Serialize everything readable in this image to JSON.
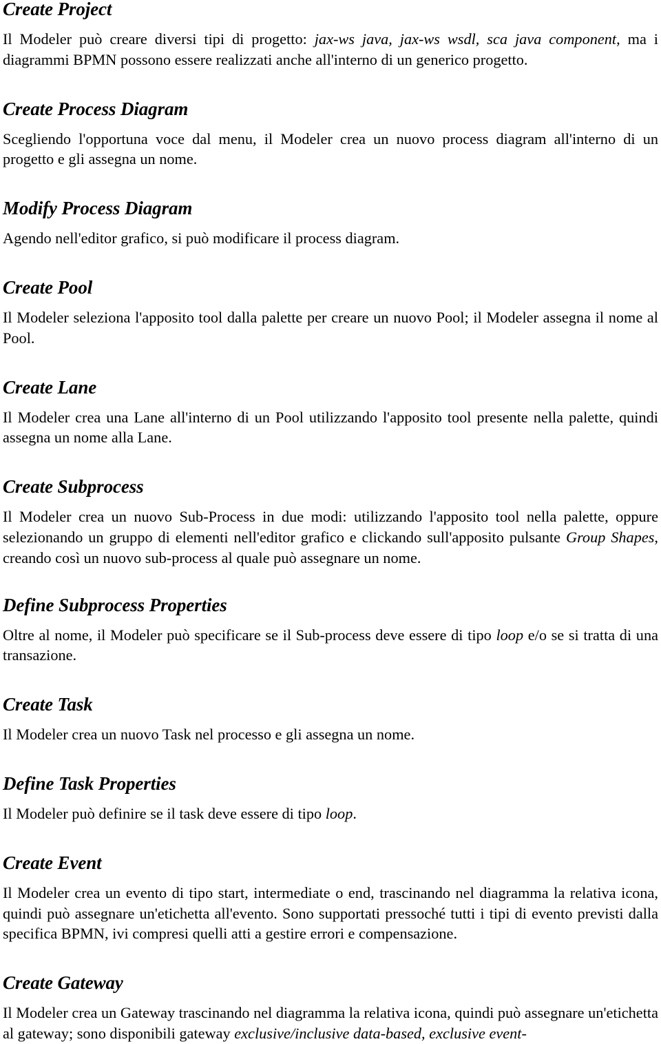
{
  "document": {
    "language": "it",
    "sections": [
      {
        "id": "create-project",
        "heading": "Create Project",
        "body_html": "Il Modeler può creare diversi tipi di progetto: <i>jax-ws java, jax-ws wsdl, sca java component</i>, ma i diagrammi BPMN possono essere realizzati anche all'interno di un generico progetto.",
        "body_text": "Il Modeler può creare diversi tipi di progetto: jax-ws java, jax-ws wsdl, sca java component, ma i diagrammi BPMN possono essere realizzati anche all'interno di un generico progetto.",
        "italic_runs": [
          "jax-ws java, jax-ws wsdl, sca java component"
        ],
        "lines": 2
      },
      {
        "id": "create-process-diagram",
        "heading": "Create Process Diagram",
        "body_html": "Scegliendo l'opportuna voce dal menu, il Modeler crea un nuovo process diagram all'interno di un progetto e gli assegna un nome.",
        "body_text": "Scegliendo l'opportuna voce dal menu, il Modeler crea un nuovo process diagram all'interno di un progetto e gli assegna un nome.",
        "italic_runs": [],
        "lines": 2
      },
      {
        "id": "modify-process-diagram",
        "heading": "Modify Process Diagram",
        "body_html": "Agendo nell'editor grafico, si può modificare il process diagram.",
        "body_text": "Agendo nell'editor grafico, si può modificare il process diagram.",
        "italic_runs": [],
        "lines": 1
      },
      {
        "id": "create-pool",
        "heading": "Create Pool",
        "body_html": "Il Modeler seleziona l'apposito tool dalla palette per creare un nuovo Pool; il Modeler assegna il nome al Pool.",
        "body_text": "Il Modeler seleziona l'apposito tool dalla palette per creare un nuovo Pool; il Modeler assegna il nome al Pool.",
        "italic_runs": [],
        "lines": 2
      },
      {
        "id": "create-lane",
        "heading": "Create Lane",
        "body_html": "Il Modeler crea una Lane all'interno di un Pool utilizzando l'apposito tool presente nella palette, quindi assegna un nome alla Lane.",
        "body_text": "Il Modeler crea una Lane all'interno di un Pool utilizzando l'apposito tool presente nella palette, quindi assegna un nome alla Lane.",
        "italic_runs": [],
        "lines": 2
      },
      {
        "id": "create-subprocess",
        "heading": "Create Subprocess",
        "body_html": "Il Modeler crea un nuovo Sub-Process in due modi: utilizzando l'apposito tool nella palette, oppure selezionando un gruppo di elementi nell'editor grafico e clickando sull'apposito pulsante <i>Group Shapes</i>, creando così un nuovo sub-process al quale può assegnare un nome.",
        "body_text": "Il Modeler crea un nuovo Sub-Process in due modi: utilizzando l'apposito tool nella palette, oppure selezionando un gruppo di elementi nell'editor grafico e clickando sull'apposito pulsante Group Shapes, creando così un nuovo sub-process al quale può assegnare un nome.",
        "italic_runs": [
          "Group Shapes"
        ],
        "lines": 3
      },
      {
        "id": "define-subprocess-properties",
        "heading": "Define Subprocess Properties",
        "body_html": "Oltre al nome, il Modeler può specificare se il Sub-process deve essere di tipo <i>loop</i> e/o se si tratta di una transazione.",
        "body_text": "Oltre al nome, il Modeler può specificare se il Sub-process deve essere di tipo loop e/o se si tratta di una transazione.",
        "italic_runs": [
          "loop"
        ],
        "lines": 2
      },
      {
        "id": "create-task",
        "heading": "Create Task",
        "body_html": "Il Modeler crea un nuovo Task nel processo e gli assegna un nome.",
        "body_text": "Il Modeler crea un nuovo Task nel processo e gli assegna un nome.",
        "italic_runs": [],
        "lines": 1
      },
      {
        "id": "define-task-properties",
        "heading": "Define Task Properties",
        "body_html": "Il Modeler può definire se il task deve essere di tipo <i>loop</i>.",
        "body_text": "Il Modeler può definire se il task deve essere di tipo loop.",
        "italic_runs": [
          "loop"
        ],
        "lines": 1
      },
      {
        "id": "create-event",
        "heading": "Create Event",
        "body_html": "Il Modeler crea un evento di tipo start, intermediate o end, trascinando nel diagramma la relativa icona, quindi può assegnare un'etichetta all'evento. Sono supportati pressoché tutti i tipi di evento previsti dalla specifica BPMN, ivi compresi quelli atti a gestire errori e compensazione.",
        "body_text": "Il Modeler crea un evento di tipo start, intermediate o end, trascinando nel diagramma la relativa icona, quindi può assegnare un'etichetta all'evento. Sono supportati pressoché tutti i tipi di evento previsti dalla specifica BPMN, ivi compresi quelli atti a gestire errori e compensazione.",
        "italic_runs": [],
        "lines": 3
      },
      {
        "id": "create-gateway",
        "heading": "Create Gateway",
        "body_html": "Il Modeler crea un Gateway trascinando nel diagramma la relativa icona, quindi può assegnare un'etichetta al gateway; sono disponibili gateway <i>exclusive/inclusive data-based, exclusive event-</i>",
        "body_text": "Il Modeler crea un Gateway trascinando nel diagramma la relativa icona, quindi può assegnare un'etichetta al gateway; sono disponibili gateway exclusive/inclusive data-based, exclusive event-",
        "italic_runs": [
          "exclusive/inclusive data-based, exclusive event-"
        ],
        "lines": 2,
        "truncated_at_page_bottom": true
      }
    ]
  }
}
